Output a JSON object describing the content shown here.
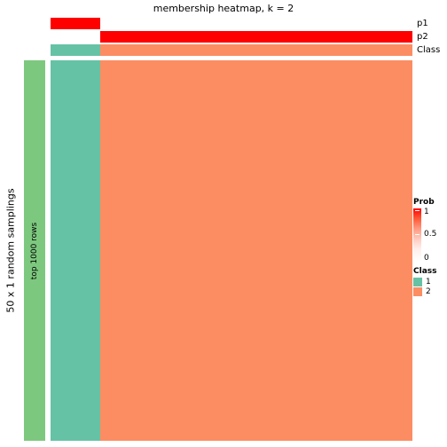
{
  "chart_data": {
    "type": "heatmap",
    "title": "membership heatmap, k = 2",
    "xlabel": "",
    "ylabel": "50 x 1 random samplings",
    "grid": false,
    "legend_position": "right",
    "row_annotation": {
      "label": "top 1000 rows",
      "color": "#7DC87F"
    },
    "column_annotations": [
      {
        "name": "p1",
        "type": "continuous",
        "segments": [
          {
            "start_pct": 0,
            "end_pct": 13.7,
            "value": 1,
            "color": "#FF0000"
          },
          {
            "start_pct": 13.7,
            "end_pct": 100,
            "value": 0,
            "color": "#FFFFFF"
          }
        ]
      },
      {
        "name": "p2",
        "type": "continuous",
        "segments": [
          {
            "start_pct": 0,
            "end_pct": 13.7,
            "value": 0,
            "color": "#FFFFFF"
          },
          {
            "start_pct": 13.7,
            "end_pct": 100,
            "value": 1,
            "color": "#FF0000"
          }
        ]
      },
      {
        "name": "Class",
        "type": "discrete",
        "segments": [
          {
            "start_pct": 0,
            "end_pct": 13.7,
            "value": "1",
            "color": "#66C2A5"
          },
          {
            "start_pct": 13.7,
            "end_pct": 100,
            "value": "2",
            "color": "#FC8D62"
          }
        ]
      }
    ],
    "body_blocks": [
      {
        "start_pct": 0,
        "end_pct": 13.7,
        "cluster": "1",
        "color": "#66C2A5"
      },
      {
        "start_pct": 13.7,
        "end_pct": 100,
        "cluster": "2",
        "color": "#FC8D62"
      }
    ],
    "legends": {
      "prob": {
        "title": "Prob",
        "type": "continuous",
        "ticks": [
          "1",
          "0.5",
          "0"
        ],
        "tick_values": [
          1,
          0.5,
          0
        ],
        "color_low": "#FFFFFF",
        "color_high": "#FF0000"
      },
      "class": {
        "title": "Class",
        "type": "discrete",
        "entries": [
          {
            "label": "1",
            "color": "#66C2A5"
          },
          {
            "label": "2",
            "color": "#FC8D62"
          }
        ]
      }
    }
  }
}
